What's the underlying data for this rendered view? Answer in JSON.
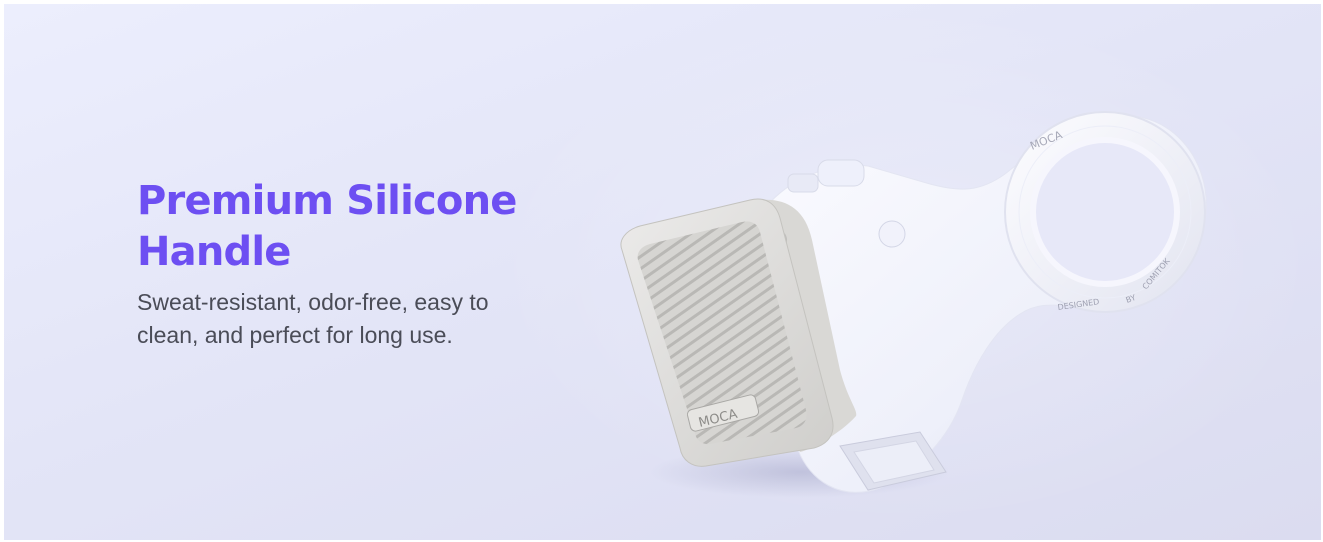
{
  "banner": {
    "headline": "Premium Silicone Handle",
    "subtitle": "Sweat-resistant, odor-free, easy to clean, and perfect for long use.",
    "accent_color": "#6d4ff2"
  },
  "product": {
    "brand_mark": "MOCA",
    "grip_brand": "MOCA",
    "ring_text_left": "DESIGNED",
    "ring_text_mid": "BY",
    "ring_text_right": "COMITOK"
  }
}
